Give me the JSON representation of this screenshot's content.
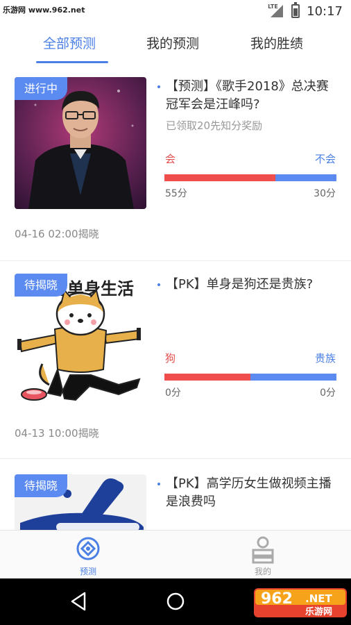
{
  "status_bar": {
    "watermark": "乐游网 www.962.net",
    "network": "LTE",
    "time": "10:17"
  },
  "tabs": [
    {
      "label": "全部预测",
      "active": true
    },
    {
      "label": "我的预测",
      "active": false
    },
    {
      "label": "我的胜绩",
      "active": false
    }
  ],
  "cards": [
    {
      "status": "进行中",
      "title": "【预测】《歌手2018》总决赛冠军会是汪峰吗?",
      "subtitle": "已领取20先知分奖励",
      "option_left": "会",
      "option_right": "不会",
      "score_left": "55分",
      "score_right": "30分",
      "left_share": 0.647,
      "reveal": "04-16 02:00揭晓"
    },
    {
      "status": "待揭晓",
      "image_caption": "的单身生活",
      "title": "【PK】单身是狗还是贵族?",
      "option_left": "狗",
      "option_right": "贵族",
      "score_left": "0分",
      "score_right": "0分",
      "left_share": 0.5,
      "reveal": "04-13 10:00揭晓"
    },
    {
      "status": "待揭晓",
      "title": "【PK】高学历女生做视频主播是浪费吗"
    }
  ],
  "bottom_nav": [
    {
      "label": "预测",
      "active": true,
      "icon": "forecast-icon"
    },
    {
      "label": "我的",
      "active": false,
      "icon": "profile-icon"
    }
  ],
  "watermark_logo": {
    "number": "962",
    "suffix": ".NET",
    "name": "乐游网"
  },
  "colors": {
    "accent": "#4a7fe5",
    "red": "#f04d4d",
    "blue_bar": "#5b8bf0"
  }
}
